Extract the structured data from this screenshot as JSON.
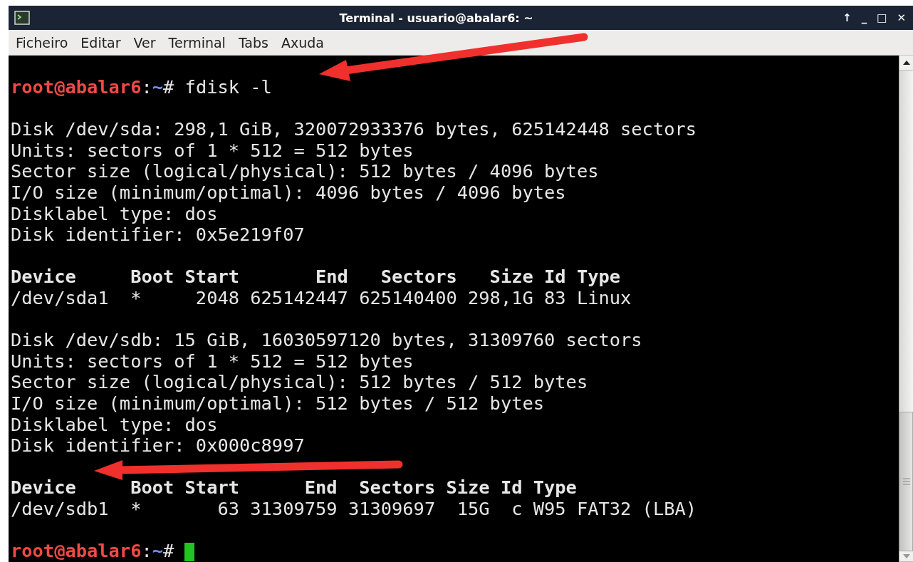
{
  "window": {
    "title": "Terminal - usuario@abalar6: ~",
    "buttons": [
      "↑",
      "_",
      "□",
      "✕"
    ]
  },
  "menu": [
    "Ficheiro",
    "Editar",
    "Ver",
    "Terminal",
    "Tabs",
    "Axuda"
  ],
  "terminal": {
    "lines": [
      {
        "kind": "prompt",
        "user_host": "root@abalar6",
        "separator": ":",
        "path": "~",
        "command": "# fdisk -l",
        "cursor": false
      },
      {
        "kind": "blank"
      },
      {
        "kind": "text",
        "text": "Disk /dev/sda: 298,1 GiB, 320072933376 bytes, 625142448 sectors"
      },
      {
        "kind": "text",
        "text": "Units: sectors of 1 * 512 = 512 bytes"
      },
      {
        "kind": "text",
        "text": "Sector size (logical/physical): 512 bytes / 4096 bytes"
      },
      {
        "kind": "text",
        "text": "I/O size (minimum/optimal): 4096 bytes / 4096 bytes"
      },
      {
        "kind": "text",
        "text": "Disklabel type: dos"
      },
      {
        "kind": "text",
        "text": "Disk identifier: 0x5e219f07"
      },
      {
        "kind": "blank"
      },
      {
        "kind": "header",
        "text": "Device     Boot Start       End   Sectors   Size Id Type"
      },
      {
        "kind": "text",
        "text": "/dev/sda1  *     2048 625142447 625140400 298,1G 83 Linux"
      },
      {
        "kind": "blank"
      },
      {
        "kind": "text",
        "text": "Disk /dev/sdb: 15 GiB, 16030597120 bytes, 31309760 sectors"
      },
      {
        "kind": "text",
        "text": "Units: sectors of 1 * 512 = 512 bytes"
      },
      {
        "kind": "text",
        "text": "Sector size (logical/physical): 512 bytes / 512 bytes"
      },
      {
        "kind": "text",
        "text": "I/O size (minimum/optimal): 512 bytes / 512 bytes"
      },
      {
        "kind": "text",
        "text": "Disklabel type: dos"
      },
      {
        "kind": "text",
        "text": "Disk identifier: 0x000c8997"
      },
      {
        "kind": "blank"
      },
      {
        "kind": "header",
        "text": "Device     Boot Start      End  Sectors Size Id Type"
      },
      {
        "kind": "text",
        "text": "/dev/sdb1  *       63 31309759 31309697  15G  c W95 FAT32 (LBA)"
      },
      {
        "kind": "blank"
      },
      {
        "kind": "prompt",
        "user_host": "root@abalar6",
        "separator": ":",
        "path": "~",
        "command": "#",
        "cursor": true
      }
    ]
  }
}
